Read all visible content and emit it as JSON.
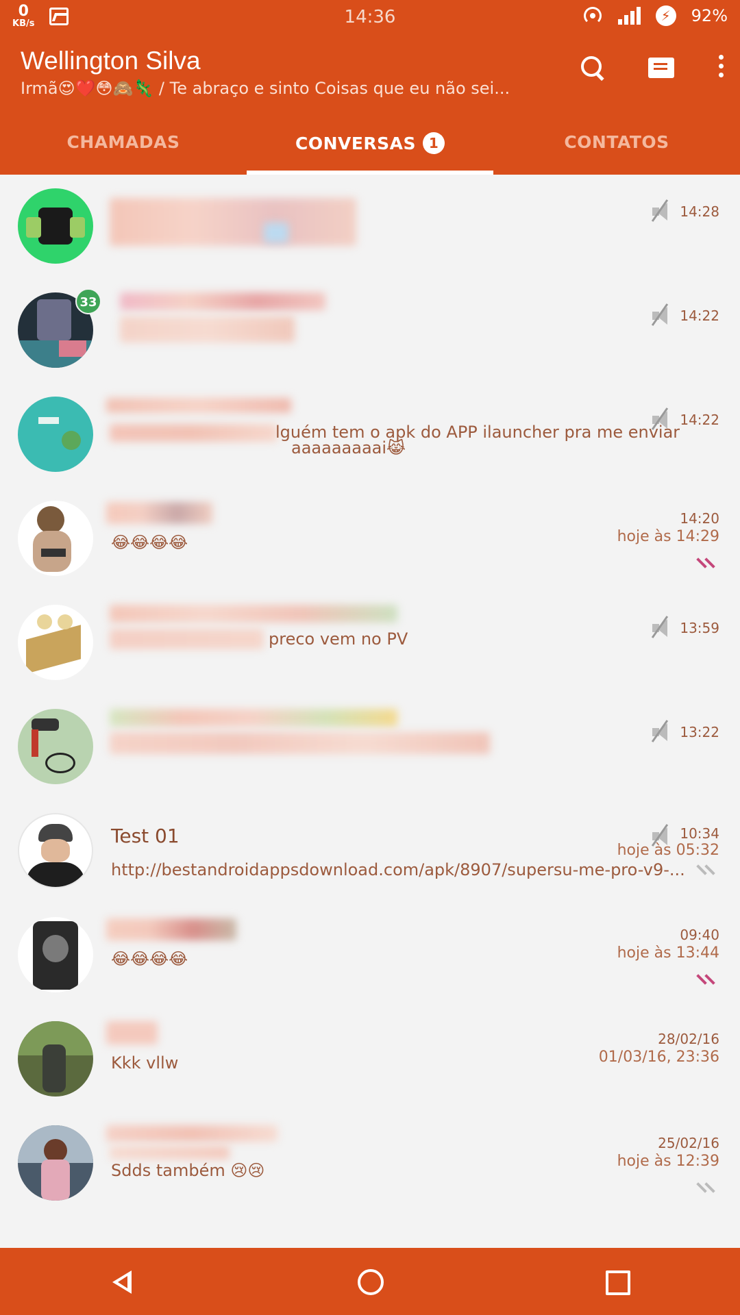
{
  "status_bar": {
    "net_speed": "0",
    "net_unit": "KB/s",
    "time": "14:36",
    "battery": "92%"
  },
  "header": {
    "title": "Wellington Silva",
    "subtitle": "Irmã😍❤️😳🙈🦎 / Te abraço e sinto Coisas que eu não sei..."
  },
  "tabs": [
    {
      "label": "CHAMADAS"
    },
    {
      "label": "CONVERSAS",
      "badge": "1"
    },
    {
      "label": "CONTATOS"
    }
  ],
  "conversations": [
    {
      "name": "",
      "preview": "",
      "time": "14:28",
      "muted": true
    },
    {
      "name": "",
      "preview": "aaaaaaaaai😹",
      "time": "14:22",
      "muted": true,
      "unread": "33"
    },
    {
      "name": "",
      "preview": "lguém tem o apk do APP ilauncher pra me enviar",
      "time": "14:22",
      "muted": true
    },
    {
      "name": "",
      "preview": "😂😂😂😂",
      "time": "14:20",
      "time_detail": "hoje às 14:29",
      "read": true
    },
    {
      "name": "",
      "preview": "preco vem no PV",
      "time": "13:59",
      "muted": true
    },
    {
      "name": "",
      "preview": "",
      "time": "13:22",
      "muted": true
    },
    {
      "name": "Test 01",
      "preview": "http://bestandroidappsdownload.com/apk/8907/supersu-me-pro-v9-...",
      "time": "10:34",
      "time_detail": "hoje às 05:32",
      "muted": true,
      "read": false
    },
    {
      "name": "",
      "preview": "😂😂😂😂",
      "time": "09:40",
      "time_detail": "hoje às 13:44",
      "read": true
    },
    {
      "name": "",
      "preview": "Kkk vllw",
      "time": "28/02/16",
      "time_detail": "01/03/16, 23:36"
    },
    {
      "name": "",
      "preview": "Sdds também 😢😢",
      "time": "25/02/16",
      "time_detail": "hoje às 12:39",
      "read": false
    }
  ],
  "colors": {
    "primary": "#d94e1a",
    "background": "#f3f3f3",
    "unread_badge": "#3fa557",
    "read_checks": "#c4477a"
  },
  "icons": {
    "search": "search-icon",
    "new_message": "new-message-icon",
    "menu": "more-vert-icon",
    "back": "back-icon",
    "home": "home-icon",
    "recents": "recents-icon"
  }
}
